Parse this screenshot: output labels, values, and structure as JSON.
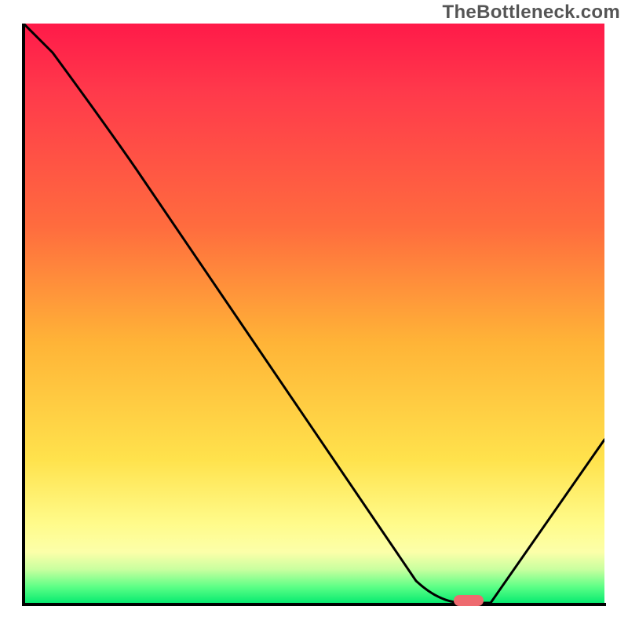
{
  "watermark": "TheBottleneck.com",
  "chart_data": {
    "type": "line",
    "title": "",
    "xlabel": "",
    "ylabel": "",
    "xlim": [
      0,
      100
    ],
    "ylim": [
      0,
      100
    ],
    "x": [
      0,
      5,
      20,
      40,
      60,
      68,
      74,
      80,
      100
    ],
    "values": [
      100,
      95,
      74,
      48,
      20,
      4,
      0,
      0,
      28
    ],
    "optimum_x": 77,
    "optimum_y": 0,
    "gradient_stops": [
      {
        "pos": 0,
        "color": "#ff1a49"
      },
      {
        "pos": 12,
        "color": "#ff3a4b"
      },
      {
        "pos": 35,
        "color": "#ff6c3e"
      },
      {
        "pos": 55,
        "color": "#ffb437"
      },
      {
        "pos": 75,
        "color": "#ffe24c"
      },
      {
        "pos": 86,
        "color": "#fffb8a"
      },
      {
        "pos": 91,
        "color": "#fcffa9"
      },
      {
        "pos": 94,
        "color": "#c8ff9f"
      },
      {
        "pos": 97,
        "color": "#5cff86"
      },
      {
        "pos": 100,
        "color": "#00e86e"
      }
    ]
  }
}
